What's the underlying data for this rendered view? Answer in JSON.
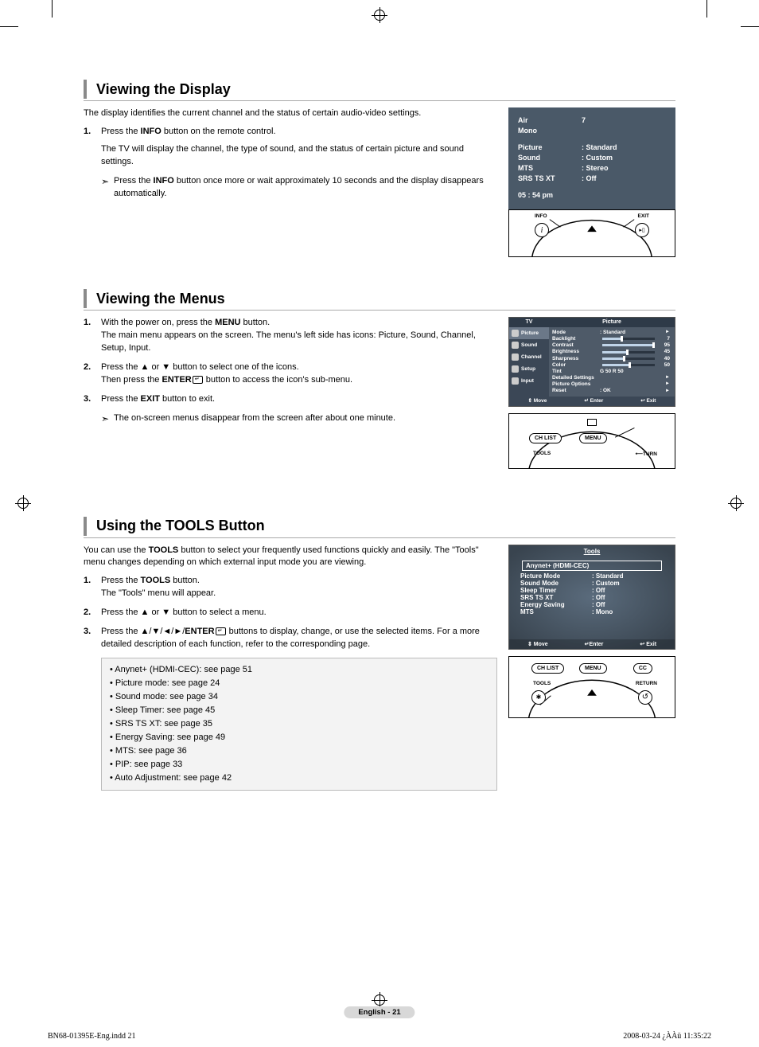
{
  "sections": {
    "sec1": {
      "title": "Viewing the Display",
      "intro": "The display identifies the current channel and the status of certain audio-video settings.",
      "step1_pre": "Press the ",
      "step1_bold": "INFO",
      "step1_post": " button on the remote control.",
      "step1_body": "The TV will display the channel, the type of sound, and the status of certain picture and sound settings.",
      "note_pre": "Press the ",
      "note_bold": "INFO",
      "note_post": " button once more or wait approximately 10 seconds and the display disappears automatically."
    },
    "sec2": {
      "title": "Viewing the Menus",
      "s1_pre": "With the power on, press the ",
      "s1_bold": "MENU",
      "s1_post": " button.",
      "s1_body": "The main menu appears on the screen. The menu's left side has icons: Picture, Sound, Channel, Setup, Input.",
      "s2_text": "Press the ▲ or ▼ button to select one of the icons.",
      "s2b_pre": "Then press the ",
      "s2b_bold": "ENTER",
      "s2b_post": " button to access the icon's sub-menu.",
      "s3_pre": "Press the ",
      "s3_bold": "EXIT",
      "s3_post": " button to exit.",
      "note": "The on-screen menus disappear from the screen after about one minute."
    },
    "sec3": {
      "title": "Using the TOOLS Button",
      "intro_pre": "You can use the ",
      "intro_bold": "TOOLS",
      "intro_post": " button to select your frequently used functions quickly and easily. The \"Tools\" menu changes depending on which external input mode you are viewing.",
      "s1_pre": "Press the ",
      "s1_bold": "TOOLS",
      "s1_post": " button.",
      "s1_body": "The \"Tools\" menu will appear.",
      "s2_text": "Press the ▲ or ▼ button to select a menu.",
      "s3_pre": "Press the ▲/▼/◄/►/",
      "s3_bold": "ENTER",
      "s3_post": " buttons to display, change, or use the selected items. For a more detailed description of each function, refer to the corresponding page.",
      "bullets": [
        "Anynet+ (HDMI-CEC): see page 51",
        "Picture mode: see page 24",
        "Sound mode: see page 34",
        "Sleep Timer: see page 45",
        "SRS TS XT: see page 35",
        "Energy Saving: see page 49",
        "MTS: see page 36",
        "PIP: see page 33",
        "Auto Adjustment: see page 42"
      ]
    }
  },
  "osd_info": {
    "air_label": "Air",
    "air_value": "7",
    "mono": "Mono",
    "rows": [
      {
        "k": "Picture",
        "v": ": Standard"
      },
      {
        "k": "Sound",
        "v": ": Custom"
      },
      {
        "k": "MTS",
        "v": ": Stereo"
      },
      {
        "k": "SRS TS XT",
        "v": ": Off"
      }
    ],
    "time": "05 : 54 pm"
  },
  "tv_menu": {
    "tv": "TV",
    "title": "Picture",
    "nav": [
      "Picture",
      "Sound",
      "Channel",
      "Setup",
      "Input"
    ],
    "rows": [
      {
        "lbl": "Mode",
        "txt": ": Standard",
        "arrow": true
      },
      {
        "lbl": "Backlight",
        "bar": 35,
        "val": "7"
      },
      {
        "lbl": "Contrast",
        "bar": 95,
        "val": "95"
      },
      {
        "lbl": "Brightness",
        "bar": 45,
        "val": "45"
      },
      {
        "lbl": "Sharpness",
        "bar": 40,
        "val": "40"
      },
      {
        "lbl": "Color",
        "bar": 50,
        "val": "50"
      },
      {
        "lbl": "Tint",
        "tint": "G 50                    R 50",
        "bar": 50
      },
      {
        "lbl": "Detailed Settings",
        "arrow": true
      },
      {
        "lbl": "Picture Options",
        "arrow": true
      },
      {
        "lbl": "Reset",
        "txt": ": OK",
        "arrow": true
      }
    ],
    "foot": {
      "move": "Move",
      "enter": "Enter",
      "exit": "Exit"
    }
  },
  "tools_osd": {
    "title": "Tools",
    "first": "Anynet+ (HDMI-CEC)",
    "rows": [
      {
        "k": "Picture Mode",
        "v": ": Standard"
      },
      {
        "k": "Sound Mode",
        "v": ": Custom"
      },
      {
        "k": "Sleep Timer",
        "v": ": Off"
      },
      {
        "k": "SRS TS XT",
        "v": ": Off"
      },
      {
        "k": "Energy Saving",
        "v": ": Off"
      },
      {
        "k": "MTS",
        "v": ": Mono"
      }
    ],
    "foot": {
      "move": "Move",
      "enter": "Enter",
      "exit": "Exit"
    }
  },
  "remote_labels": {
    "info": "INFO",
    "exit": "EXIT",
    "chlist": "CH LIST",
    "menu": "MENU",
    "tools": "TOOLS",
    "return": "RETURN",
    "cc": "CC",
    "turn": "TURN"
  },
  "arrows": {
    "note_marker": "➣",
    "updown": "⇕",
    "enter_sym": "↵",
    "exit_sym": "↩"
  },
  "footer": {
    "page": "English - 21",
    "print_left": "BN68-01395E-Eng.indd   21",
    "print_right": "2008-03-24   ¿ÀÀü 11:35:22"
  }
}
